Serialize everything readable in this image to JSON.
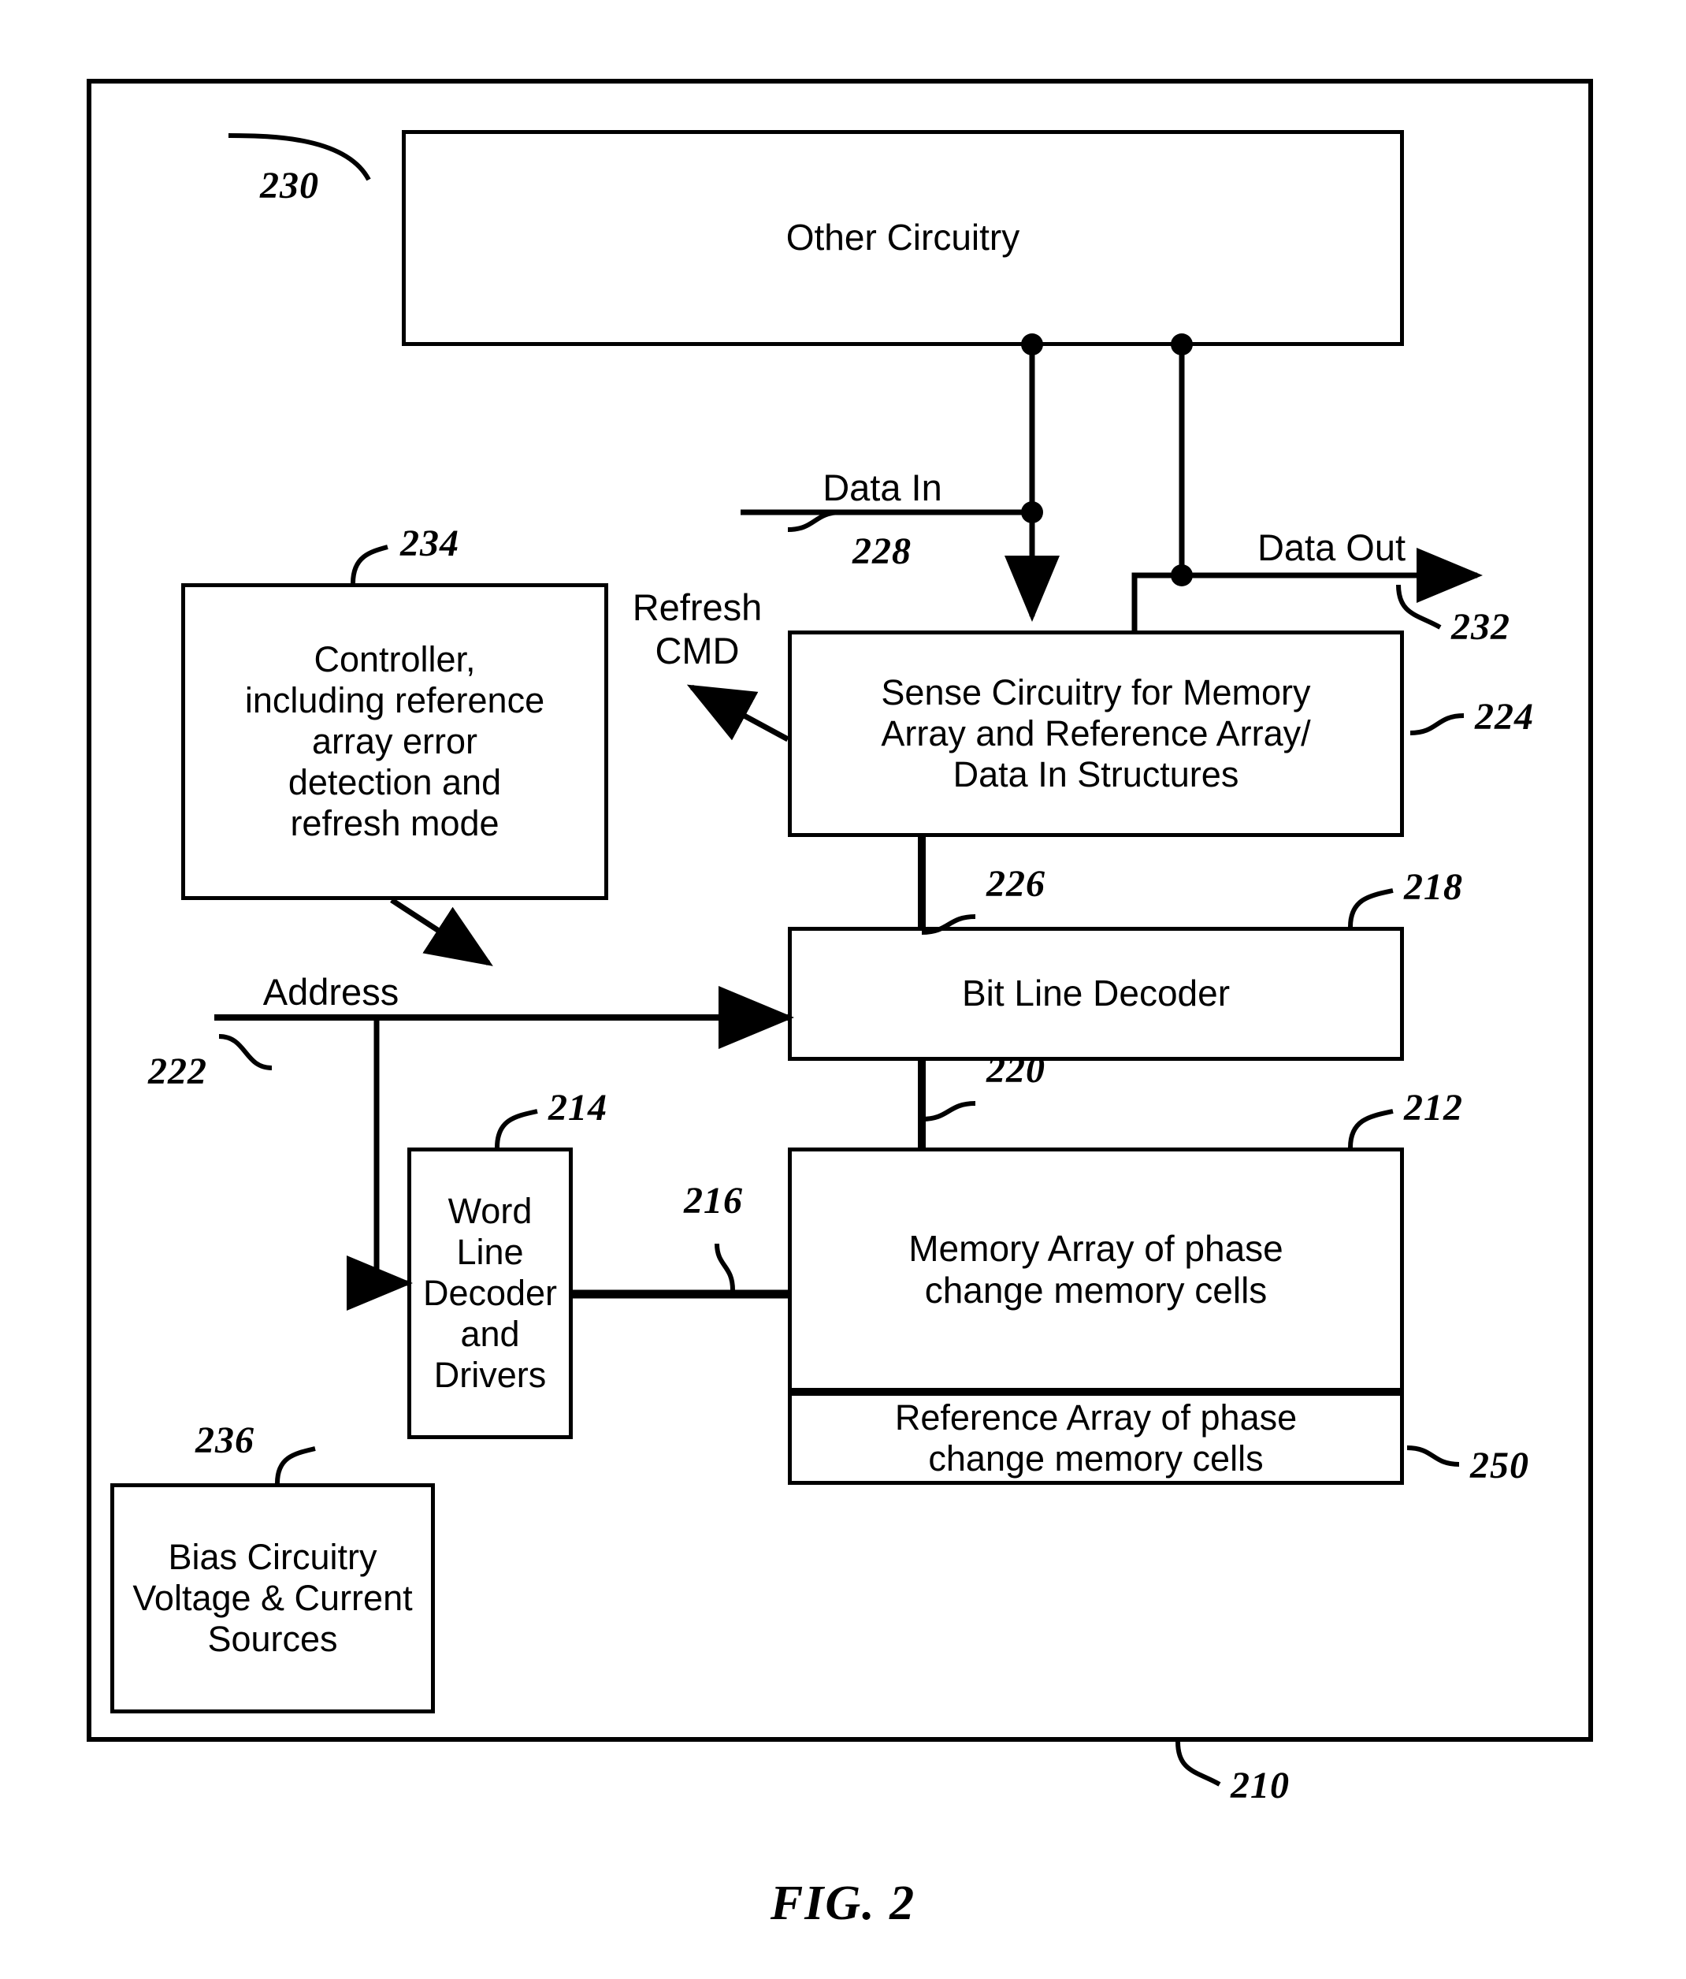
{
  "figure": {
    "caption": "FIG. 2",
    "outer_ref": "210"
  },
  "blocks": [
    {
      "id": "other_circuitry",
      "label": "Other Circuitry",
      "ref": "230"
    },
    {
      "id": "controller",
      "label": "Controller,\nincluding reference\narray error\ndetection and\nrefresh mode",
      "ref": "234"
    },
    {
      "id": "sense_circuitry",
      "label": "Sense Circuitry for Memory\nArray and Reference Array/\nData In Structures",
      "ref": "224"
    },
    {
      "id": "bit_line_decoder",
      "label": "Bit Line Decoder",
      "ref": "218"
    },
    {
      "id": "word_line_decoder",
      "label": "Word\nLine\nDecoder\nand\nDrivers",
      "ref": "214"
    },
    {
      "id": "memory_array",
      "label": "Memory Array of phase\nchange memory cells",
      "ref": "212"
    },
    {
      "id": "reference_array",
      "label": "Reference Array of phase\nchange memory cells",
      "ref": "250"
    },
    {
      "id": "bias_circuitry",
      "label": "Bias Circuitry\nVoltage & Current\nSources",
      "ref": "236"
    }
  ],
  "signals": [
    {
      "id": "data_in",
      "label": "Data In",
      "ref": "228"
    },
    {
      "id": "data_out",
      "label": "Data Out",
      "ref": "232"
    },
    {
      "id": "refresh_cmd",
      "label": "Refresh\nCMD",
      "ref": ""
    },
    {
      "id": "address",
      "label": "Address",
      "ref": "222"
    }
  ],
  "bus_refs": [
    {
      "id": "sense_to_bitline",
      "ref": "226"
    },
    {
      "id": "bitline_to_array",
      "ref": "220"
    },
    {
      "id": "wordline_to_array",
      "ref": "216"
    }
  ],
  "colors": {
    "line": "#000000",
    "background": "#ffffff"
  }
}
